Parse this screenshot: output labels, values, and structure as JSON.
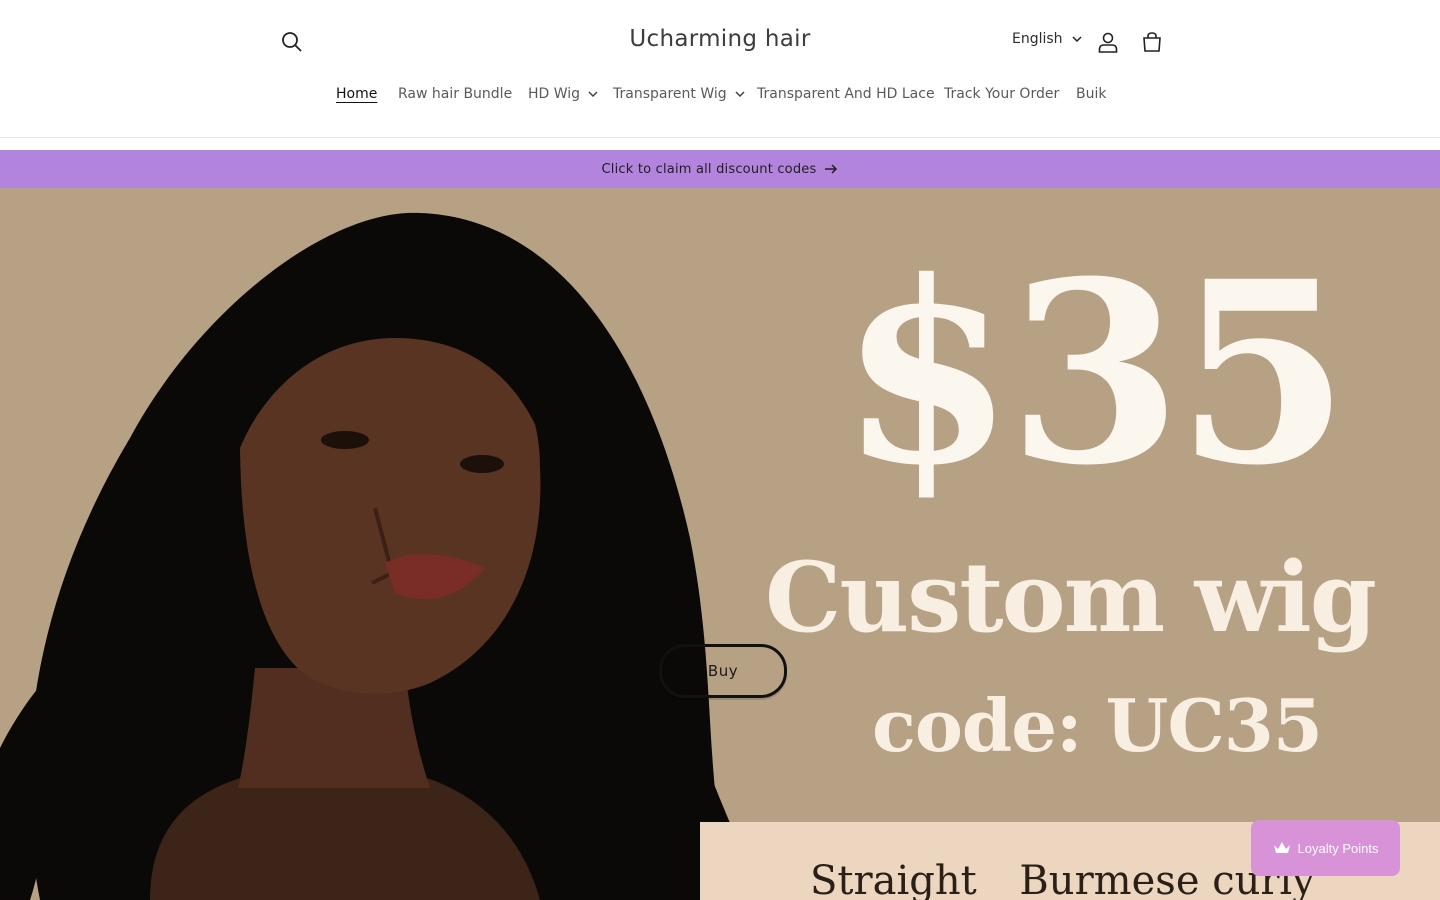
{
  "header": {
    "logo": "Ucharming hair",
    "language": "English",
    "icons": [
      "search-icon",
      "account-icon",
      "cart-icon"
    ]
  },
  "nav": {
    "items": [
      {
        "label": "Home",
        "active": true
      },
      {
        "label": "Raw hair Bundle"
      },
      {
        "label": "HD Wig",
        "dropdown": true
      },
      {
        "label": "Transparent Wig",
        "dropdown": true
      },
      {
        "label": "Transparent And HD Lace"
      },
      {
        "label": "Track Your Order"
      },
      {
        "label": "Buik"
      }
    ]
  },
  "banner": {
    "text": "Click to claim all discount codes",
    "color": "#b284dd"
  },
  "hero": {
    "price": "$35",
    "headline": "Custom wig",
    "code": "code: UC35",
    "styles": [
      "Straight",
      "Burmese curly"
    ],
    "buy_label": "Buy",
    "background": "#b7a185"
  },
  "loyalty": {
    "label": "Loyalty Points",
    "color": "#d892d8"
  }
}
